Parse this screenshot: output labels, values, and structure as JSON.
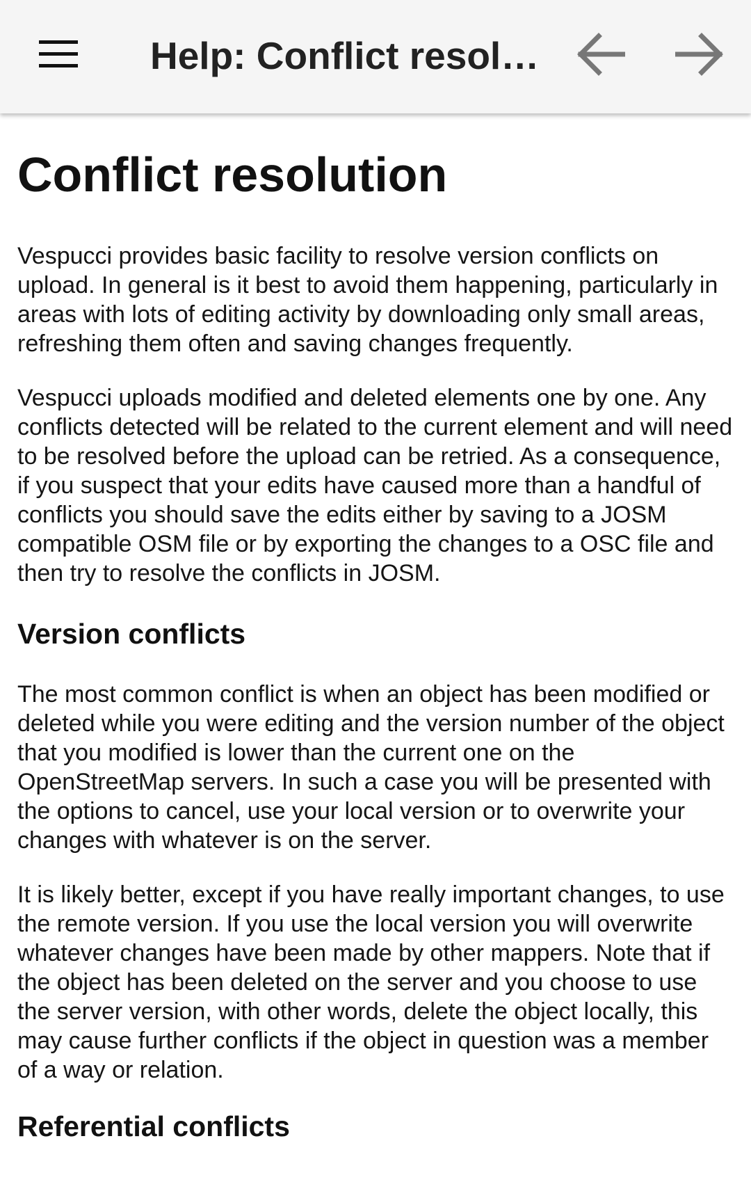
{
  "appbar": {
    "title": "Help: Conflict resolution",
    "menu_icon": "hamburger-menu-icon",
    "back_icon": "arrow-back-icon",
    "forward_icon": "arrow-forward-icon",
    "background": "#f5f5f5"
  },
  "article": {
    "title": "Conflict resolution",
    "paragraphs_intro": [
      "Vespucci provides basic facility to resolve version conflicts on upload. In general is it best to avoid them happening, particularly in areas with lots of editing activity by downloading only small areas, refreshing them often and saving changes frequently.",
      "Vespucci uploads modified and deleted elements one by one. Any conflicts detected will be related to the current element and will need to be resolved before the upload can be retried. As a consequence, if you suspect that your edits have caused more than a handful of conflicts you should save the edits either by saving to a JOSM compatible OSM file or by exporting the changes to a OSC file and then try to resolve the conflicts in JOSM."
    ],
    "section_version": {
      "heading": "Version conflicts",
      "paragraphs": [
        "The most common conflict is when an object has been modified or deleted while you were editing and the version number of the object that you modified is lower than the current one on the OpenStreetMap servers. In such a case you will be presented with the options to cancel, use your local version or to overwrite your changes with whatever is on the server.",
        "It is likely better, except if you have really important changes, to use the remote version. If you use the local version you will overwrite whatever changes have been made by other mappers. Note that if the object has been deleted on the server and you choose to use the server version, with other words, delete the object locally, this may cause further conflicts if the object in question was a member of a way or relation."
      ]
    },
    "section_referential": {
      "heading": "Referential conflicts"
    }
  }
}
